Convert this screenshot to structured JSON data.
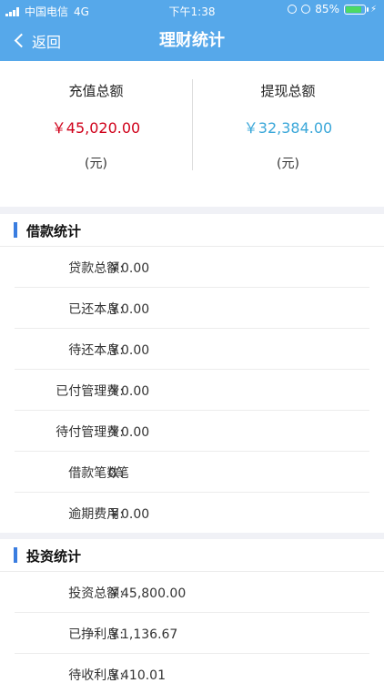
{
  "status": {
    "carrier": "中国电信",
    "network": "4G",
    "time": "下午1:38",
    "battery": "85%"
  },
  "nav": {
    "back_label": "返回",
    "title": "理财统计"
  },
  "summary": {
    "recharge": {
      "label": "充值总额",
      "amount": "￥45,020.00",
      "unit": "(元)",
      "color": "#d0021b"
    },
    "withdraw": {
      "label": "提现总额",
      "amount": "￥32,384.00",
      "unit": "(元)",
      "color": "#3aa7d9"
    }
  },
  "loan": {
    "title": "借款统计",
    "rows": [
      {
        "label": "贷款总额:",
        "value": "￥0.00"
      },
      {
        "label": "已还本息:",
        "value": "￥0.00"
      },
      {
        "label": "待还本息:",
        "value": "￥0.00"
      },
      {
        "label": "已付管理费:",
        "value": "￥0.00"
      },
      {
        "label": "待付管理费:",
        "value": "￥0.00"
      },
      {
        "label": "借款笔数:",
        "value": "0笔"
      },
      {
        "label": "逾期费用:",
        "value": "￥0.00"
      }
    ]
  },
  "invest": {
    "title": "投资统计",
    "rows": [
      {
        "label": "投资总额:",
        "value": "￥45,800.00"
      },
      {
        "label": "已挣利息:",
        "value": "￥1,136.67"
      },
      {
        "label": "待收利息:",
        "value": "￥410.01"
      }
    ]
  }
}
